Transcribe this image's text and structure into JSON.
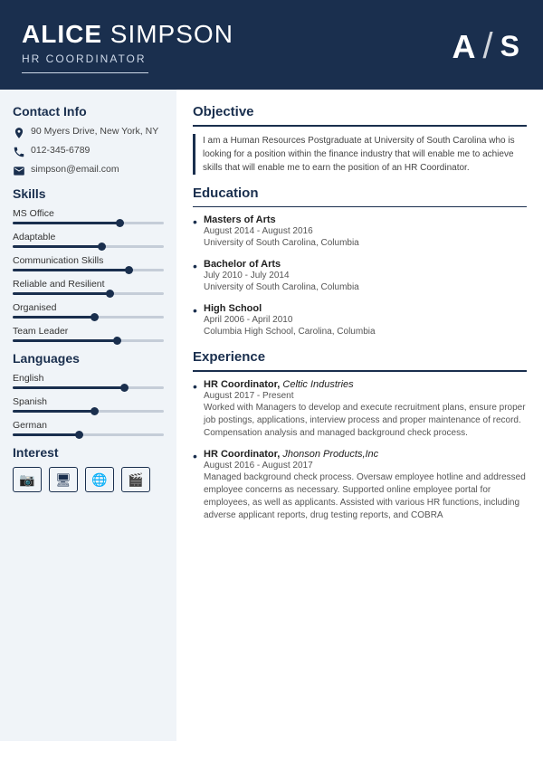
{
  "header": {
    "first_name": "ALICE",
    "last_name": "SIMPSON",
    "title": "HR COORDINATOR",
    "initials_first": "A",
    "initials_last": "S"
  },
  "sidebar": {
    "contact_title": "Contact Info",
    "contact": {
      "address": "90 Myers Drive, New York, NY",
      "phone": "012-345-6789",
      "email": "simpson@email.com"
    },
    "skills_title": "Skills",
    "skills": [
      {
        "name": "MS Office",
        "pct": 72
      },
      {
        "name": "Adaptable",
        "pct": 60
      },
      {
        "name": "Communication Skills",
        "pct": 78
      },
      {
        "name": "Reliable and Resilient",
        "pct": 65
      },
      {
        "name": "Organised",
        "pct": 55
      },
      {
        "name": "Team Leader",
        "pct": 70
      }
    ],
    "languages_title": "Languages",
    "languages": [
      {
        "name": "English",
        "pct": 75
      },
      {
        "name": "Spanish",
        "pct": 55
      },
      {
        "name": "German",
        "pct": 45
      }
    ],
    "interest_title": "Interest",
    "interests": [
      {
        "icon": "📷",
        "label": "camera-icon"
      },
      {
        "icon": "🖥",
        "label": "computer-icon"
      },
      {
        "icon": "🌐",
        "label": "globe-icon"
      },
      {
        "icon": "🎬",
        "label": "video-icon"
      }
    ]
  },
  "main": {
    "objective_title": "Objective",
    "objective_text": "I am a Human Resources Postgraduate at University of South Carolina who is looking for a position within the finance industry that will enable me to achieve skills that will enable me to earn the position of an HR Coordinator.",
    "education_title": "Education",
    "education": [
      {
        "degree": "Masters of Arts",
        "dates": "August 2014 - August 2016",
        "school": "University of South Carolina, Columbia"
      },
      {
        "degree": "Bachelor of Arts",
        "dates": "July 2010 - July 2014",
        "school": "University of South Carolina, Columbia"
      },
      {
        "degree": "High School",
        "dates": "April 2006 - April 2010",
        "school": "Columbia High School, Carolina, Columbia"
      }
    ],
    "experience_title": "Experience",
    "experience": [
      {
        "title": "HR Coordinator",
        "company": "Celtic Industries",
        "dates": "August 2017 - Present",
        "desc": "Worked with Managers to develop and execute recruitment plans, ensure proper job postings, applications, interview process and proper maintenance of record. Compensation analysis and managed background check process."
      },
      {
        "title": "HR Coordinator",
        "company": "Jhonson Products,Inc",
        "dates": "August 2016 - August 2017",
        "desc": "Managed background check process. Oversaw employee hotline and addressed employee concerns as necessary. Supported online employee portal for employees, as well as applicants. Assisted with various HR functions, including adverse applicant reports, drug testing reports, and COBRA"
      }
    ]
  }
}
